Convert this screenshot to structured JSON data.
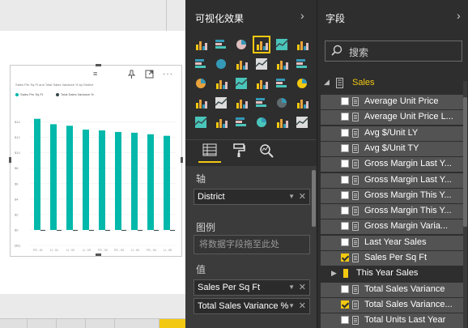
{
  "visualizations_pane": {
    "title": "可视化效果"
  },
  "fields_pane": {
    "title": "字段",
    "search_placeholder": "搜索"
  },
  "wells": {
    "axis_label": "轴",
    "axis_field": "District",
    "legend_label": "图例",
    "legend_placeholder": "将数据字段拖至此处",
    "values_label": "值",
    "values_fields": [
      "Sales Per Sq Ft",
      "Total Sales Variance %"
    ]
  },
  "table": {
    "name": "Sales"
  },
  "fields": [
    {
      "label": "Average Unit Price",
      "checked": false,
      "kind": "measure"
    },
    {
      "label": "Average Unit Price L...",
      "checked": false,
      "kind": "measure"
    },
    {
      "label": "Avg $/Unit LY",
      "checked": false,
      "kind": "measure"
    },
    {
      "label": "Avg $/Unit TY",
      "checked": false,
      "kind": "measure"
    },
    {
      "label": "Gross Margin Last Y...",
      "checked": false,
      "kind": "measure"
    },
    {
      "label": "Gross Margin Last Y...",
      "checked": false,
      "kind": "measure"
    },
    {
      "label": "Gross Margin This Y...",
      "checked": false,
      "kind": "measure"
    },
    {
      "label": "Gross Margin This Y...",
      "checked": false,
      "kind": "measure"
    },
    {
      "label": "Gross Margin Varia...",
      "checked": false,
      "kind": "measure"
    },
    {
      "label": "Last Year Sales",
      "checked": false,
      "kind": "measure"
    },
    {
      "label": "Sales Per Sq Ft",
      "checked": true,
      "kind": "measure"
    },
    {
      "label": "This Year Sales",
      "checked": false,
      "kind": "folder"
    },
    {
      "label": "Total Sales Variance",
      "checked": false,
      "kind": "measure"
    },
    {
      "label": "Total Sales Variance...",
      "checked": true,
      "kind": "measure"
    },
    {
      "label": "Total Units Last Year",
      "checked": false,
      "kind": "measure"
    }
  ],
  "visual": {
    "title": "Sales Per Sq Ft and Total Sales Variance % by District",
    "legend": [
      {
        "name": "Sales Per Sq Ft",
        "color": "#01b8aa"
      },
      {
        "name": "Total Sales Variance %",
        "color": "#374649"
      }
    ]
  },
  "chart_data": {
    "type": "bar",
    "title": "Sales Per Sq Ft and Total Sales Variance % by District",
    "categories": [
      "FD - 01",
      "LI - 01",
      "LI - 02",
      "LI - 03",
      "FD - 02",
      "FD - 03",
      "LI - 04",
      "FD - 04",
      "LI - 05"
    ],
    "y_ticks": [
      "$14",
      "$12",
      "$10",
      "$8",
      "$6",
      "$4",
      "$2",
      "$0",
      "($2)"
    ],
    "ylim": [
      -2,
      15
    ],
    "series": [
      {
        "name": "Sales Per Sq Ft",
        "color": "#01b8aa",
        "values": [
          14.4,
          13.7,
          13.5,
          13.0,
          12.9,
          12.7,
          12.6,
          12.4,
          12.2
        ]
      },
      {
        "name": "Total Sales Variance %",
        "color": "#374649",
        "values": [
          -0.05,
          -0.05,
          -0.05,
          -0.05,
          -0.05,
          -0.05,
          -0.05,
          -0.05,
          -0.05
        ]
      }
    ],
    "grid": true,
    "legend": "top-left"
  },
  "colors": {
    "accent": "#f2c811",
    "pane_bg": "#2e2e2e",
    "field_row": "#535353"
  }
}
